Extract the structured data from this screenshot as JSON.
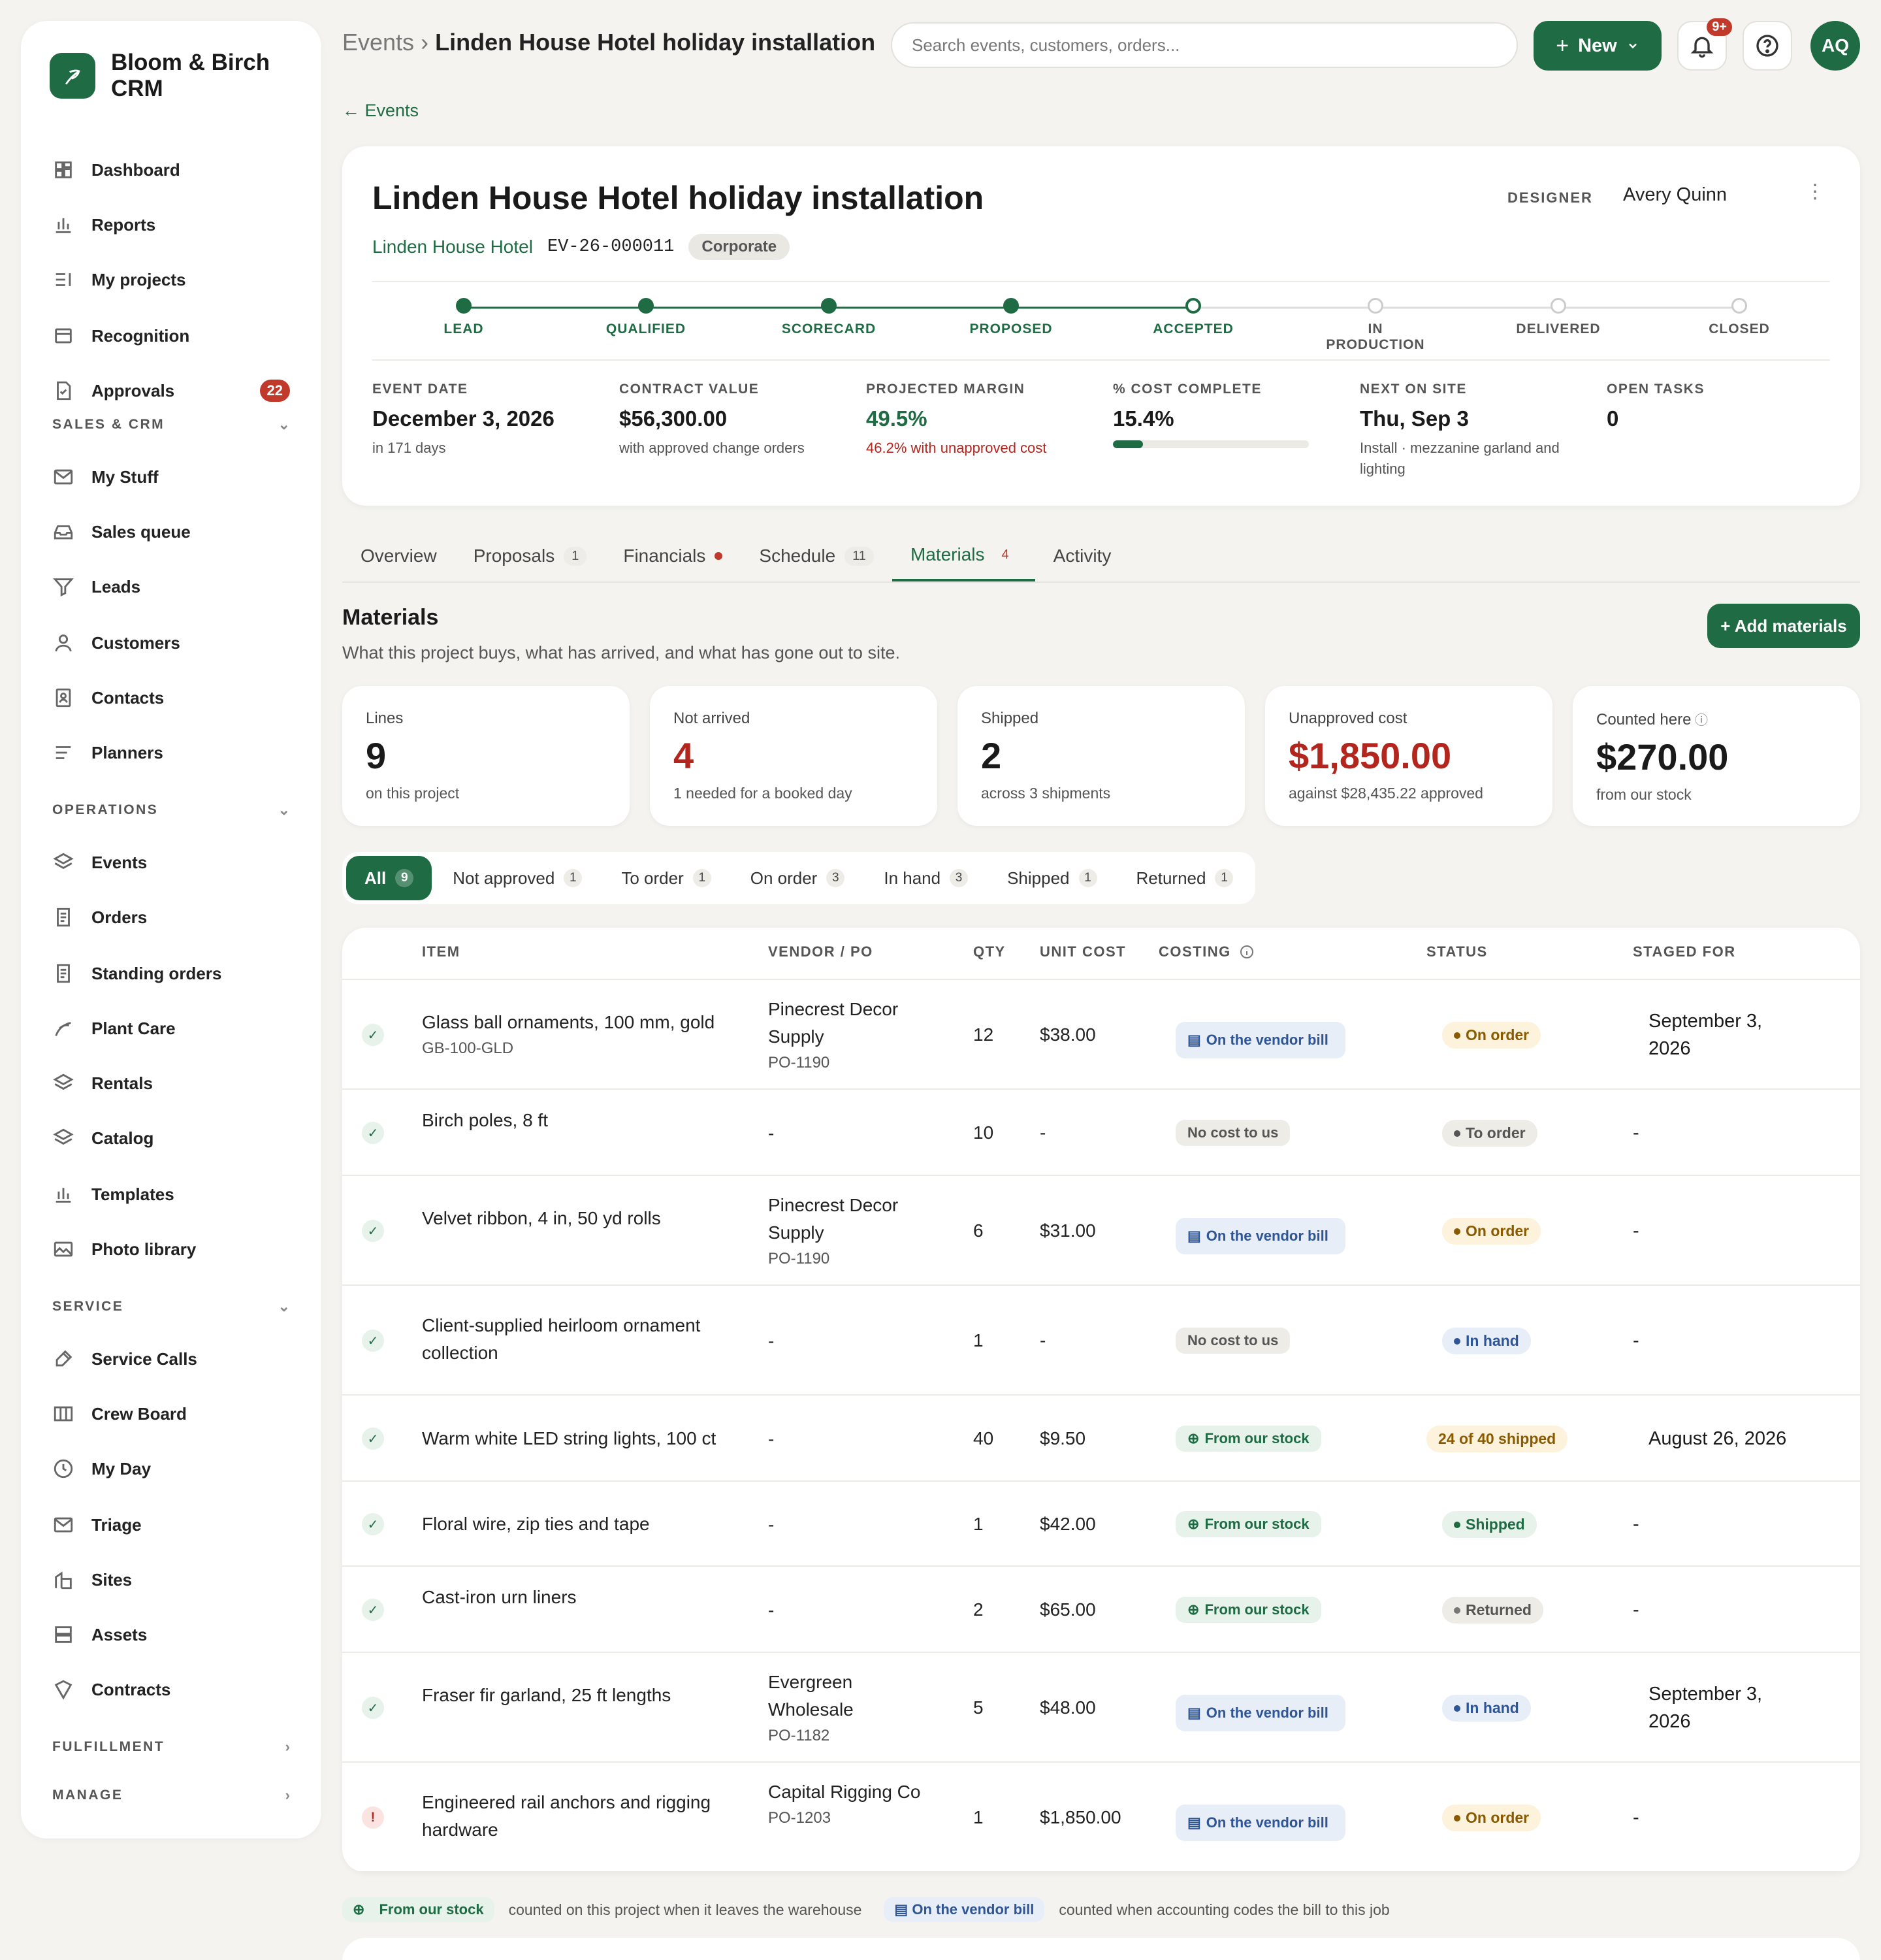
{
  "brand": {
    "name_line1": "Bloom & Birch",
    "name_line2": "CRM"
  },
  "sidebar": {
    "items": [
      {
        "label": "Dashboard",
        "icon": "dashboard-icon"
      },
      {
        "label": "Reports",
        "icon": "bar-chart-icon"
      },
      {
        "label": "My projects",
        "icon": "list-icon"
      },
      {
        "label": "Recognition",
        "icon": "list-box-icon"
      },
      {
        "label": "Approvals",
        "icon": "document-check-icon",
        "badge": "22"
      }
    ],
    "sections": {
      "sales": "SALES & CRM",
      "operations": "OPERATIONS",
      "service": "SERVICE",
      "fulfillment": "FULFILLMENT",
      "manage": "MANAGE"
    },
    "sales_items": [
      "My Stuff",
      "Sales queue",
      "Leads",
      "Customers",
      "Contacts",
      "Planners"
    ],
    "operations_items": [
      "Events",
      "Orders",
      "Standing orders",
      "Plant Care",
      "Rentals",
      "Catalog",
      "Templates",
      "Photo library"
    ],
    "service_items": [
      "Service Calls",
      "Crew Board",
      "My Day",
      "Triage",
      "Sites",
      "Assets",
      "Contracts"
    ]
  },
  "topbar": {
    "crumb_parent": "Events",
    "crumb_sep": "›",
    "crumb_current": "Linden House Hotel holiday installation",
    "search_placeholder": "Search events, customers, orders...",
    "new_label": "New",
    "notif_badge": "9+",
    "avatar": "AQ"
  },
  "back_link": "← Events",
  "event": {
    "title": "Linden House Hotel holiday installation",
    "customer": "Linden House Hotel",
    "code": "EV-26-000011",
    "type": "Corporate",
    "designer_label": "DESIGNER",
    "designer": "Avery Quinn",
    "stages": [
      "LEAD",
      "QUALIFIED",
      "SCORECARD",
      "PROPOSED",
      "ACCEPTED",
      "IN PRODUCTION",
      "DELIVERED",
      "CLOSED"
    ],
    "current_stage_index": 4,
    "stats": [
      {
        "label": "EVENT DATE",
        "value": "December 3, 2026",
        "sub": "in 171 days"
      },
      {
        "label": "CONTRACT VALUE",
        "value": "$56,300.00",
        "sub": "with approved change orders"
      },
      {
        "label": "PROJECTED MARGIN",
        "value": "49.5%",
        "sub": "46.2% with unapproved cost"
      },
      {
        "label": "% COST COMPLETE",
        "value": "15.4%",
        "progress": 0.154
      },
      {
        "label": "NEXT ON SITE",
        "value": "Thu, Sep 3",
        "sub": "Install · mezzanine garland and lighting"
      },
      {
        "label": "OPEN TASKS",
        "value": "0"
      }
    ]
  },
  "tabs": [
    {
      "label": "Overview"
    },
    {
      "label": "Proposals",
      "count": "1"
    },
    {
      "label": "Financials",
      "dot": true
    },
    {
      "label": "Schedule",
      "count": "11"
    },
    {
      "label": "Materials",
      "count": "4",
      "active": true
    },
    {
      "label": "Activity"
    }
  ],
  "materials": {
    "title": "Materials",
    "subtitle": "What this project buys, what has arrived, and what has gone out to site.",
    "add_label": "+ Add materials",
    "kpis": [
      {
        "label": "Lines",
        "value": "9",
        "sub": "on this project"
      },
      {
        "label": "Not arrived",
        "value": "4",
        "sub": "1 needed for a booked day",
        "red": true
      },
      {
        "label": "Shipped",
        "value": "2",
        "sub": "across 3 shipments"
      },
      {
        "label": "Unapproved cost",
        "value": "$1,850.00",
        "sub": "against $28,435.22 approved",
        "red": true
      },
      {
        "label": "Counted here",
        "value": "$270.00",
        "sub": "from our stock"
      }
    ],
    "filters": [
      {
        "label": "All",
        "count": "9",
        "active": true
      },
      {
        "label": "Not approved",
        "count": "1"
      },
      {
        "label": "To order",
        "count": "1"
      },
      {
        "label": "On order",
        "count": "3"
      },
      {
        "label": "In hand",
        "count": "3"
      },
      {
        "label": "Shipped",
        "count": "1"
      },
      {
        "label": "Returned",
        "count": "1"
      }
    ],
    "columns": {
      "item": "ITEM",
      "vendor": "VENDOR / PO",
      "qty": "QTY",
      "unit": "UNIT COST",
      "costing": "COSTING",
      "status": "STATUS",
      "staged": "STAGED FOR"
    },
    "rows": [
      {
        "item": "Glass ball ornaments, 100 mm, gold",
        "sku": "GB-100-GLD",
        "vendor": "Pinecrest Decor Supply",
        "po": "PO-1190",
        "qty": "12",
        "unit": "$38.00",
        "cost": "On the vendor bill",
        "cost_type": "vendor",
        "status": "On order",
        "status_type": "onorder",
        "staged": "September 3, 2026"
      },
      {
        "item": "Birch poles, 8 ft",
        "vendor": "-",
        "qty": "10",
        "unit": "-",
        "cost": "No cost to us",
        "cost_type": "nocost",
        "status": "To order",
        "status_type": "toorder",
        "staged": "-"
      },
      {
        "item": "Velvet ribbon, 4 in, 50 yd rolls",
        "vendor": "Pinecrest Decor Supply",
        "po": "PO-1190",
        "qty": "6",
        "unit": "$31.00",
        "cost": "On the vendor bill",
        "cost_type": "vendor",
        "status": "On order",
        "status_type": "onorder",
        "staged": "-"
      },
      {
        "item": "Client-supplied heirloom ornament collection",
        "vendor": "-",
        "qty": "1",
        "unit": "-",
        "cost": "No cost to us",
        "cost_type": "nocost",
        "status": "In hand",
        "status_type": "inhand",
        "staged": "-"
      },
      {
        "item": "Warm white LED string lights, 100 ct",
        "vendor": "-",
        "qty": "40",
        "unit": "$9.50",
        "cost": "From our stock",
        "cost_type": "stock",
        "status": "24 of 40 shipped",
        "status_type": "partial",
        "staged": "August 26, 2026"
      },
      {
        "item": "Floral wire, zip ties and tape",
        "vendor": "-",
        "qty": "1",
        "unit": "$42.00",
        "cost": "From our stock",
        "cost_type": "stock",
        "status": "Shipped",
        "status_type": "shipped",
        "staged": "-"
      },
      {
        "item": "Cast-iron urn liners",
        "vendor": "-",
        "qty": "2",
        "unit": "$65.00",
        "cost": "From our stock",
        "cost_type": "stock",
        "status": "Returned",
        "status_type": "returned",
        "staged": "-"
      },
      {
        "item": "Fraser fir garland, 25 ft lengths",
        "vendor": "Evergreen Wholesale",
        "po": "PO-1182",
        "qty": "5",
        "unit": "$48.00",
        "cost": "On the vendor bill",
        "cost_type": "vendor",
        "status": "In hand",
        "status_type": "inhand",
        "staged": "September 3, 2026"
      },
      {
        "item": "Engineered rail anchors and rigging hardware",
        "vendor": "Capital Rigging Co",
        "po": "PO-1203",
        "qty": "1",
        "unit": "$1,850.00",
        "cost": "On the vendor bill",
        "cost_type": "vendor",
        "status": "On order",
        "status_type": "onorder",
        "staged": "-",
        "warn": true
      }
    ],
    "legend": {
      "stock_chip": "From our stock",
      "stock_text": "counted on this project when it leaves the warehouse",
      "vendor_chip": "On the vendor bill",
      "vendor_text": "counted when accounting codes the bill to this job"
    }
  }
}
